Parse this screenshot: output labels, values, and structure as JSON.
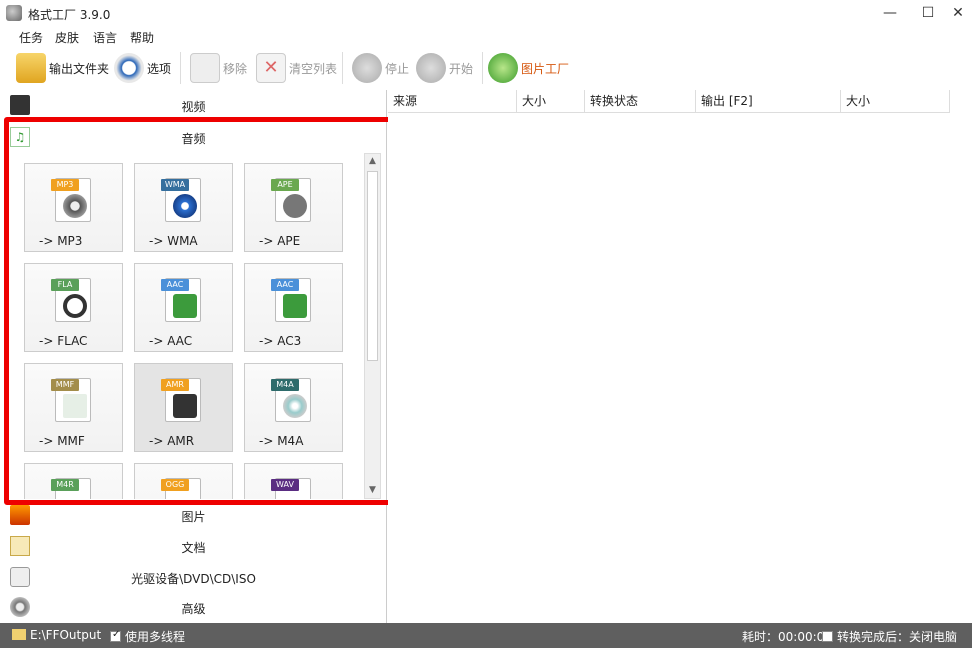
{
  "window": {
    "title": "格式工厂 3.9.0",
    "minimize": "—",
    "maximize": "☐",
    "close": "✕"
  },
  "menu": [
    "任务",
    "皮肤",
    "语言",
    "帮助"
  ],
  "toolbar": {
    "output_folder": "输出文件夹",
    "options": "选项",
    "remove": "移除",
    "clear_list": "清空列表",
    "stop": "停止",
    "start": "开始",
    "picture_factory": "图片工厂"
  },
  "categories": {
    "video": "视频",
    "audio": "音频",
    "picture": "图片",
    "document": "文档",
    "optical": "光驱设备\\DVD\\CD\\ISO",
    "advanced": "高级"
  },
  "tiles": [
    {
      "tag": "MP3",
      "label": "-> MP3",
      "tag_color": "#f0a020",
      "glyph_color": "#555"
    },
    {
      "tag": "WMA",
      "label": "-> WMA",
      "tag_color": "#356f9e",
      "glyph_color": "#2b6fd0"
    },
    {
      "tag": "APE",
      "label": "-> APE",
      "tag_color": "#6aa84f",
      "glyph_color": "#666"
    },
    {
      "tag": "FLA",
      "label": "-> FLAC",
      "tag_color": "#5aa05a",
      "glyph_color": "#333"
    },
    {
      "tag": "AAC",
      "label": "-> AAC",
      "tag_color": "#4a90d9",
      "glyph_color": "#3c9b3c"
    },
    {
      "tag": "AAC",
      "label": "-> AC3",
      "tag_color": "#4a90d9",
      "glyph_color": "#3c9b3c"
    },
    {
      "tag": "MMF",
      "label": "-> MMF",
      "tag_color": "#a38d4a",
      "glyph_color": "#ccc"
    },
    {
      "tag": "AMR",
      "label": "-> AMR",
      "tag_color": "#f0a020",
      "glyph_color": "#333"
    },
    {
      "tag": "M4A",
      "label": "-> M4A",
      "tag_color": "#2e6b6b",
      "glyph_color": "#6aa"
    },
    {
      "tag": "M4R",
      "label": "",
      "tag_color": "#5aa05a",
      "glyph_color": "#555"
    },
    {
      "tag": "OGG",
      "label": "",
      "tag_color": "#f0a020",
      "glyph_color": "#555"
    },
    {
      "tag": "WAV",
      "label": "",
      "tag_color": "#5a2d82",
      "glyph_color": "#555"
    }
  ],
  "file_columns": [
    "来源",
    "大小",
    "转换状态",
    "输出 [F2]",
    "大小"
  ],
  "status": {
    "output_path": "E:\\FFOutput",
    "multithread": "使用多线程",
    "elapsed": "耗时：00:00:00",
    "shutdown": "转换完成后：关闭电脑"
  },
  "colors": {
    "selection_border": "#e00000",
    "statusbar_bg": "#5f5f5f"
  }
}
